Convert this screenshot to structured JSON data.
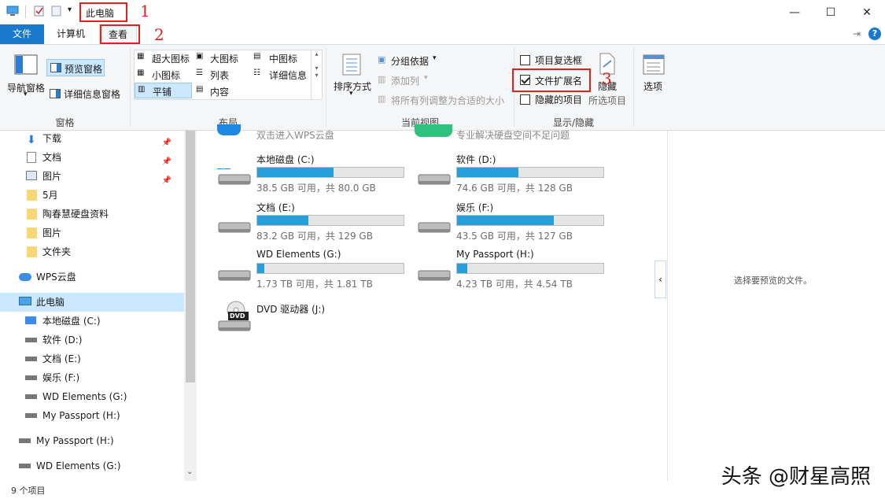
{
  "titlebar": {
    "title": "此电脑",
    "minimize": "—",
    "maximize": "☐",
    "close": "✕"
  },
  "tabs": {
    "file": "文件",
    "computer": "计算机",
    "view": "查看"
  },
  "ribbon": {
    "panes": {
      "label": "窗格",
      "nav_pane": "导航窗格",
      "preview_pane": "预览窗格",
      "details_pane": "详细信息窗格"
    },
    "layout": {
      "label": "布局",
      "extra_large": "超大图标",
      "large": "大图标",
      "medium": "中图标",
      "small": "小图标",
      "list": "列表",
      "details": "详细信息",
      "tiles": "平铺",
      "content": "内容"
    },
    "current_view": {
      "label": "当前视图",
      "sort_by": "排序方式",
      "group_by": "分组依据",
      "add_columns": "添加列",
      "fit_columns": "将所有列调整为合适的大小"
    },
    "show_hide": {
      "label": "显示/隐藏",
      "item_checkboxes": "项目复选框",
      "item_checkboxes_checked": false,
      "file_extensions": "文件扩展名",
      "file_extensions_checked": true,
      "hidden_items": "隐藏的项目",
      "hidden_items_checked": false,
      "hide_selected": "隐藏",
      "hide_selected_2": "所选项目"
    },
    "options": "选项"
  },
  "annotations": [
    "1",
    "2",
    "3"
  ],
  "nav": {
    "items": [
      {
        "label": "下载",
        "pinned": true
      },
      {
        "label": "文档",
        "pinned": true
      },
      {
        "label": "图片",
        "pinned": true
      },
      {
        "label": "5月"
      },
      {
        "label": "陶春慧硬盘资料"
      },
      {
        "label": "图片"
      },
      {
        "label": "文件夹"
      },
      {
        "label": "WPS云盘"
      },
      {
        "label": "此电脑"
      },
      {
        "label": "本地磁盘 (C:)"
      },
      {
        "label": "软件 (D:)"
      },
      {
        "label": "文档 (E:)"
      },
      {
        "label": "娱乐 (F:)"
      },
      {
        "label": "WD Elements (G:)"
      },
      {
        "label": "My Passport (H:)"
      },
      {
        "label": "My Passport (H:)"
      },
      {
        "label": "WD Elements (G:)"
      }
    ]
  },
  "content": {
    "top_left": "双击进入WPS云盘",
    "top_right": "专业解决硬盘空间不足问题",
    "drives": [
      {
        "name": "本地磁盘 (C:)",
        "size": "38.5 GB 可用，共 80.0 GB",
        "used": 0.52
      },
      {
        "name": "软件 (D:)",
        "size": "74.6 GB 可用，共 128 GB",
        "used": 0.42
      },
      {
        "name": "文档 (E:)",
        "size": "83.2 GB 可用，共 129 GB",
        "used": 0.35
      },
      {
        "name": "娱乐 (F:)",
        "size": "43.5 GB 可用，共 127 GB",
        "used": 0.66
      },
      {
        "name": "WD Elements (G:)",
        "size": "1.73 TB 可用，共 1.81 TB",
        "used": 0.05
      },
      {
        "name": "My Passport (H:)",
        "size": "4.23 TB 可用，共 4.54 TB",
        "used": 0.07
      }
    ],
    "dvd": {
      "name": "DVD 驱动器 (J:)",
      "badge": "DVD"
    }
  },
  "preview": {
    "empty_text": "选择要预览的文件。"
  },
  "status": {
    "count": "9 个项目"
  },
  "watermark": "头条 @财星高照",
  "colors": {
    "accent": "#1979ca",
    "bar": "#26a0da",
    "annotation": "#e0221a"
  }
}
